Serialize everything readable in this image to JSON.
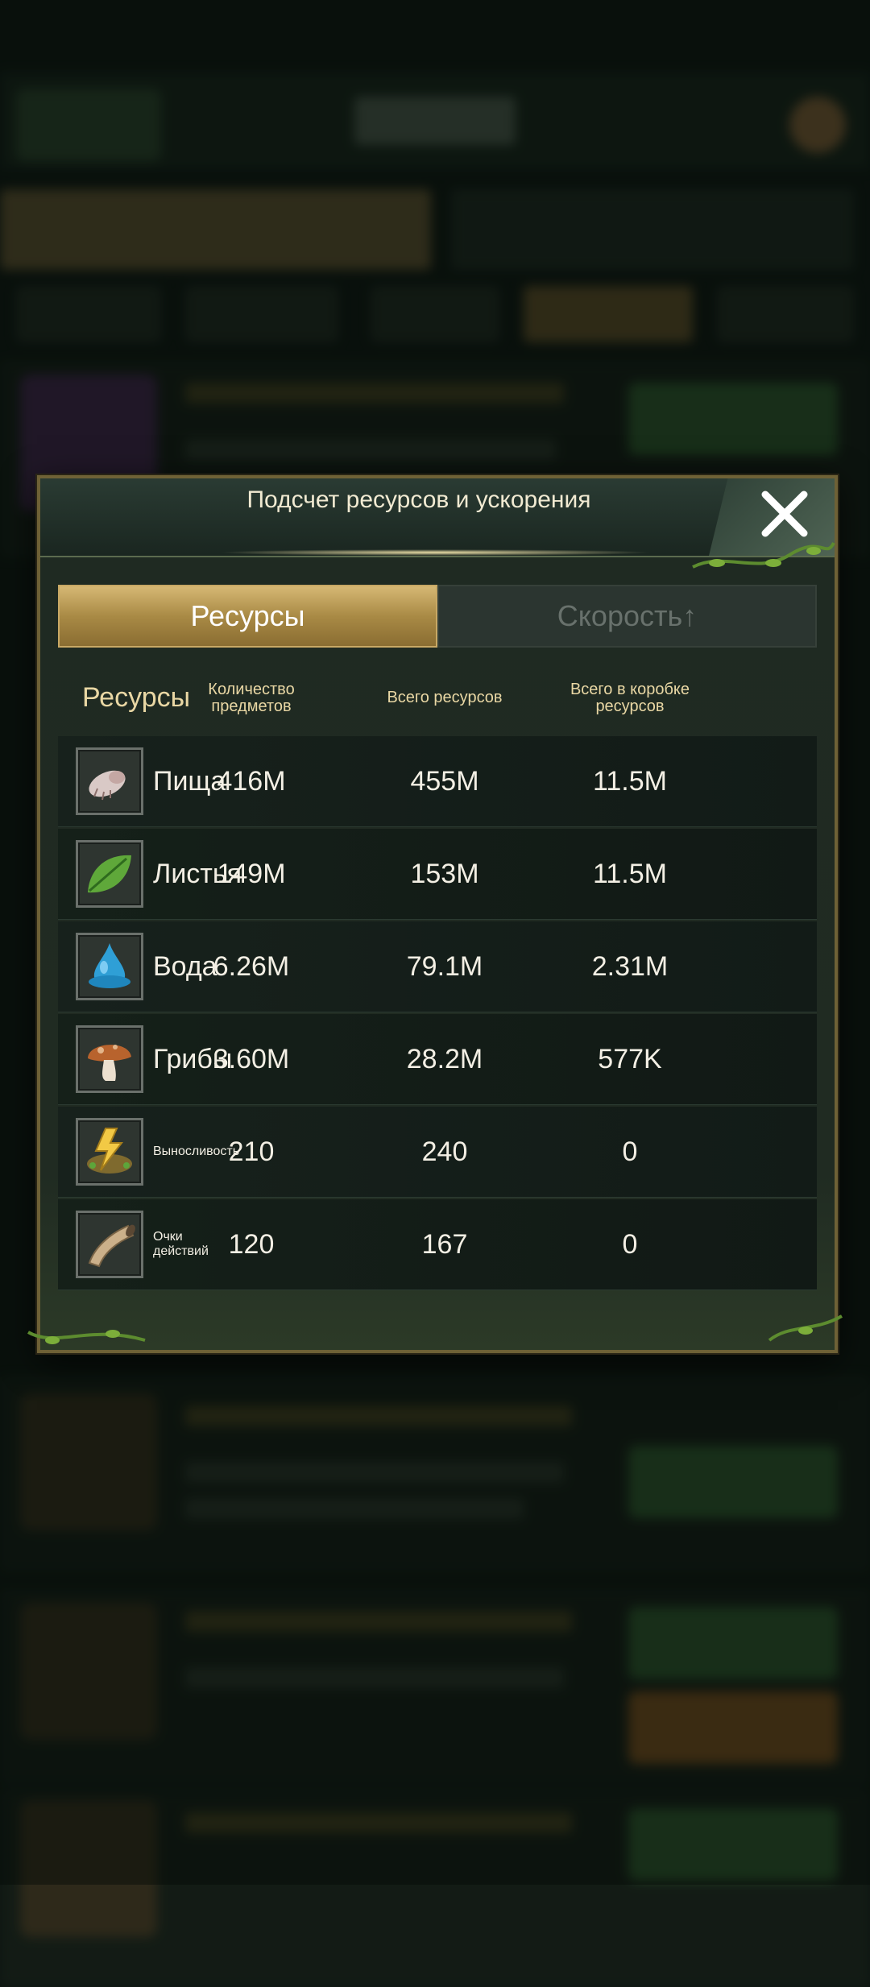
{
  "modal": {
    "title": "Подсчет ресурсов и ускорения",
    "close_icon": "close-x-icon"
  },
  "tabs": [
    {
      "label": "Ресурсы",
      "active": true
    },
    {
      "label": "Скорость↑",
      "active": false
    }
  ],
  "columns": {
    "name": "Ресурсы",
    "items": "Количество предметов",
    "total": "Всего ресурсов",
    "box": "Всего в коробке ресурсов"
  },
  "rows": [
    {
      "name": "Пища",
      "icon": "food-larva-icon",
      "items": "416M",
      "total": "455M",
      "box": "11.5M"
    },
    {
      "name": "Листья",
      "icon": "leaf-icon",
      "items": "149M",
      "total": "153M",
      "box": "11.5M"
    },
    {
      "name": "Вода",
      "icon": "water-drop-icon",
      "items": "6.26M",
      "total": "79.1M",
      "box": "2.31M"
    },
    {
      "name": "Грибы",
      "icon": "mushroom-icon",
      "items": "3.60M",
      "total": "28.2M",
      "box": "577K"
    },
    {
      "name": "Выносливость",
      "icon": "stamina-lightning-icon",
      "items": "210",
      "total": "240",
      "box": "0"
    },
    {
      "name": "Очки действий",
      "icon": "horn-icon",
      "items": "120",
      "total": "167",
      "box": "0"
    }
  ],
  "colors": {
    "accent_gold": "#c8a865",
    "frame": "#6e6136",
    "text": "#f3efe4"
  }
}
